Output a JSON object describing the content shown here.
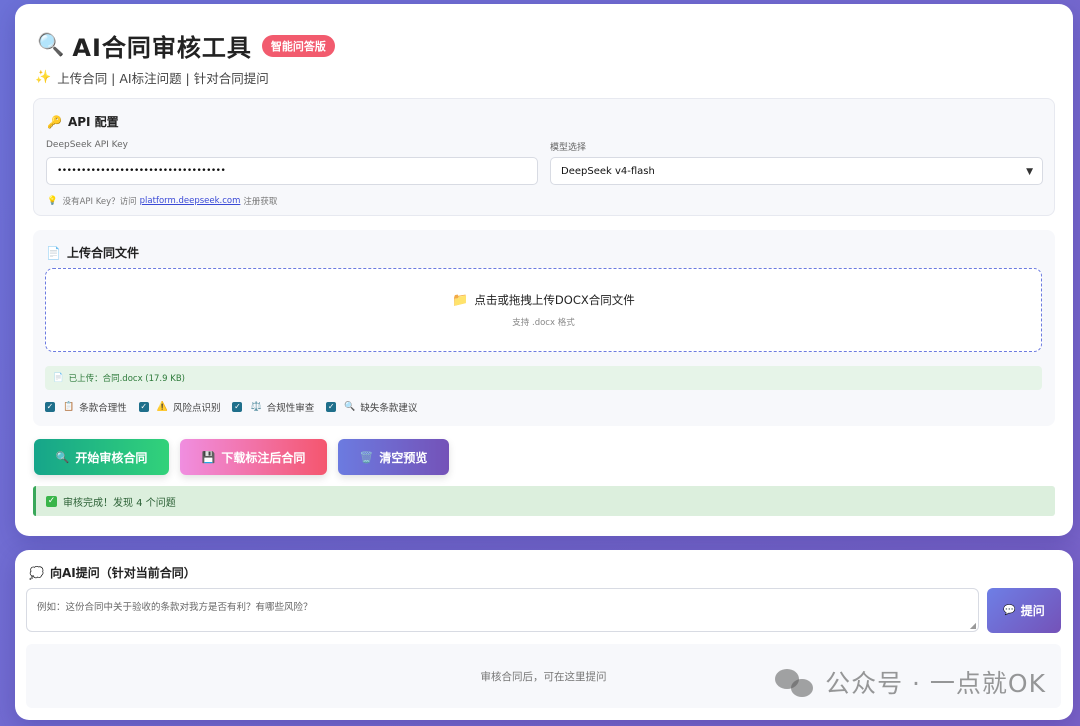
{
  "header": {
    "title_icon": "magnifier-icon",
    "title": "AI合同审核工具",
    "badge": "智能问答版",
    "subtitle": "上传合同 | AI标注问题 | 针对合同提问"
  },
  "api_config": {
    "title": "API 配置",
    "key_label": "DeepSeek API Key",
    "key_value": "•••••••••••••••••••••••••••••••••••",
    "model_label": "模型选择",
    "model_value": "DeepSeek v4-flash",
    "hint_prefix": "没有API Key？访问",
    "hint_link": "platform.deepseek.com",
    "hint_suffix": "注册获取"
  },
  "upload": {
    "title": "上传合同文件",
    "drop_text": "点击或拖拽上传DOCX合同文件",
    "drop_sub": "支持 .docx 格式",
    "uploaded_text": "已上传：合同.docx (17.9 KB)",
    "options": [
      {
        "label": "条款合理性",
        "checked": true,
        "icon": "clipboard-icon"
      },
      {
        "label": "风险点识别",
        "checked": true,
        "icon": "warning-icon"
      },
      {
        "label": "合规性审查",
        "checked": true,
        "icon": "scales-icon"
      },
      {
        "label": "缺失条款建议",
        "checked": true,
        "icon": "search-icon"
      }
    ]
  },
  "actions": {
    "review": "开始审核合同",
    "download": "下载标注后合同",
    "clear": "清空预览"
  },
  "status": {
    "text": "审核完成！发现 4 个问题"
  },
  "chat": {
    "title": "向AI提问（针对当前合同）",
    "placeholder": "例如：这份合同中关于验收的条款对我方是否有利？有哪些风险？",
    "ask_button": "提问",
    "empty_text": "审核合同后，可在这里提问"
  },
  "watermark": {
    "text": "公众号 · 一点就OK"
  },
  "colors": {
    "accent": "#6c7be0",
    "badge": "#f25b6e",
    "success": "#39a85a"
  }
}
